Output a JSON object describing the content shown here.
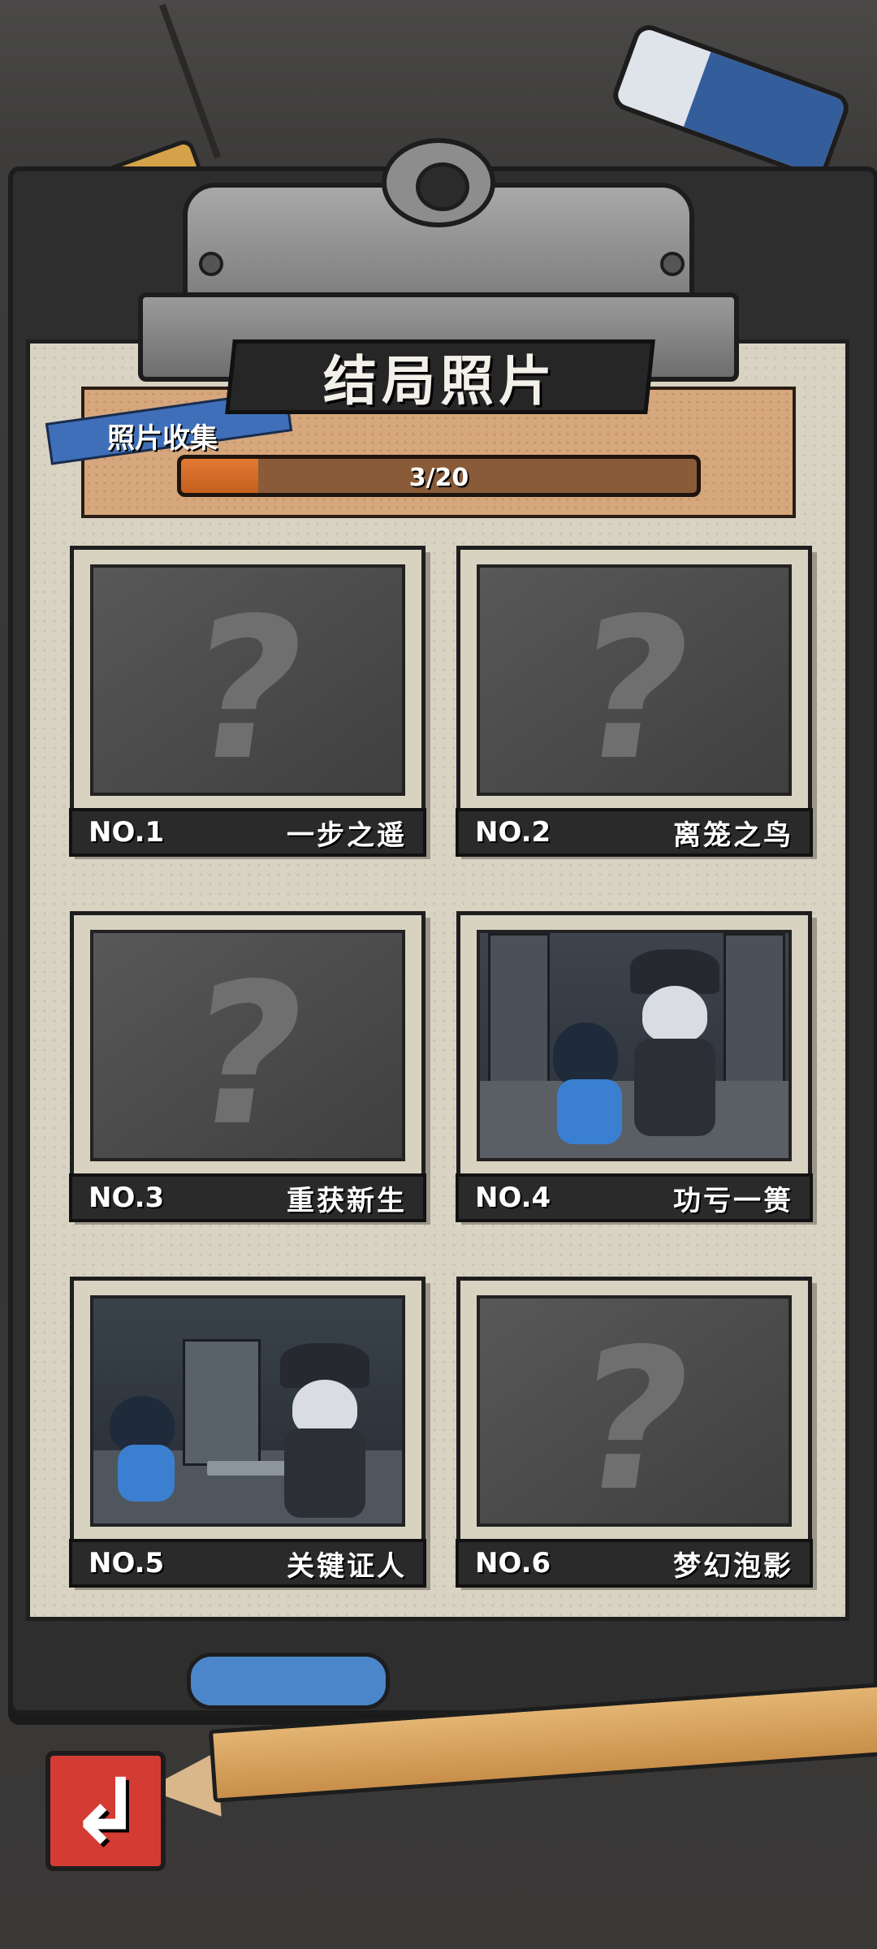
{
  "header": {
    "title": "结局照片"
  },
  "progress": {
    "label": "照片收集",
    "text": "3/20",
    "collected": 3,
    "total": 20
  },
  "photos": [
    {
      "no": "NO.1",
      "name": "一步之遥",
      "unlocked": false
    },
    {
      "no": "NO.2",
      "name": "离笼之鸟",
      "unlocked": false
    },
    {
      "no": "NO.3",
      "name": "重获新生",
      "unlocked": false
    },
    {
      "no": "NO.4",
      "name": "功亏一篑",
      "unlocked": true
    },
    {
      "no": "NO.5",
      "name": "关键证人",
      "unlocked": true
    },
    {
      "no": "NO.6",
      "name": "梦幻泡影",
      "unlocked": false
    }
  ],
  "locked_symbol": "?",
  "back_button": {
    "icon": "back-arrow-icon",
    "symbol": "↲"
  },
  "colors": {
    "accent": "#e27a33",
    "back": "#d43c33",
    "paper": "#d9d3c4"
  }
}
